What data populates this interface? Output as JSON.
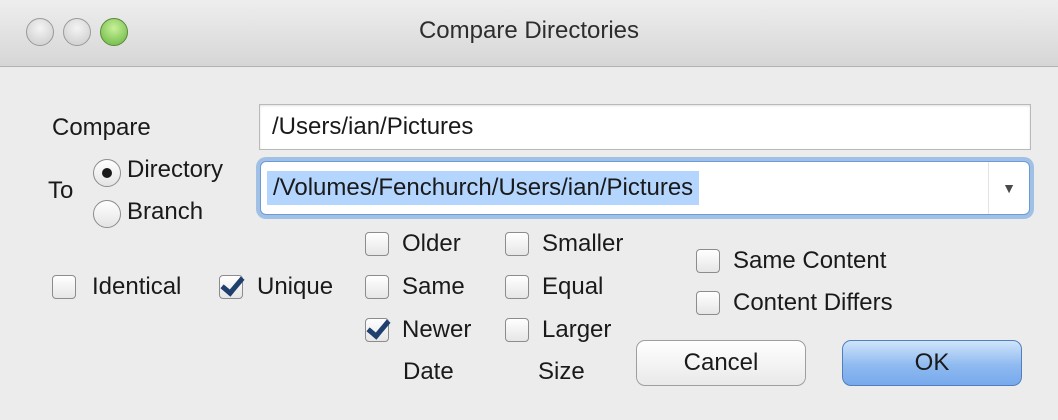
{
  "window": {
    "title": "Compare Directories"
  },
  "compare": {
    "label": "Compare",
    "value": "/Users/ian/Pictures"
  },
  "to": {
    "label": "To",
    "options": [
      {
        "label": "Directory",
        "selected": true
      },
      {
        "label": "Branch",
        "selected": false
      }
    ],
    "value": "/Volumes/Fenchurch/Users/ian/Pictures"
  },
  "filters": {
    "identical": {
      "label": "Identical",
      "checked": false
    },
    "unique": {
      "label": "Unique",
      "checked": true
    }
  },
  "date": {
    "header": "Date",
    "older": {
      "label": "Older",
      "checked": false
    },
    "same": {
      "label": "Same",
      "checked": false
    },
    "newer": {
      "label": "Newer",
      "checked": true
    }
  },
  "size": {
    "header": "Size",
    "smaller": {
      "label": "Smaller",
      "checked": false
    },
    "equal": {
      "label": "Equal",
      "checked": false
    },
    "larger": {
      "label": "Larger",
      "checked": false
    }
  },
  "content": {
    "same": {
      "label": "Same Content",
      "checked": false
    },
    "differs": {
      "label": "Content Differs",
      "checked": false
    }
  },
  "buttons": {
    "cancel": "Cancel",
    "ok": "OK"
  }
}
